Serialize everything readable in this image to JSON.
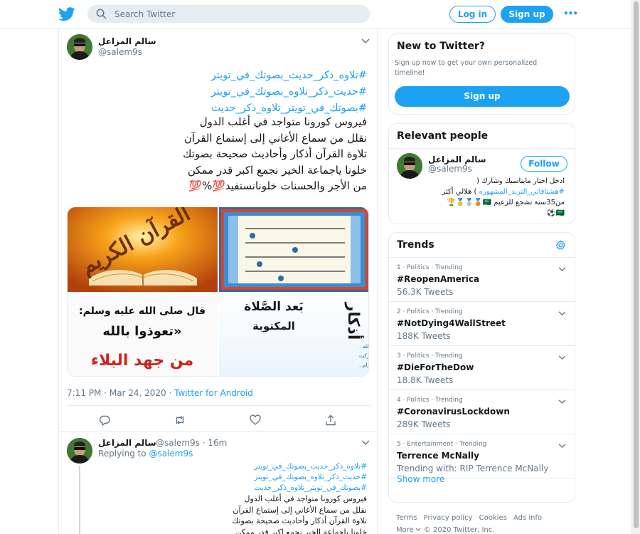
{
  "topbar": {
    "search_placeholder": "Search Twitter",
    "login_label": "Log in",
    "signup_label": "Sign up",
    "more_label": "•••"
  },
  "colors": {
    "accent": "#1da1f2",
    "text": "#14171a",
    "muted": "#657786",
    "border": "#e6ecf0"
  },
  "main_tweet": {
    "name": "سالم المزاعل",
    "handle": "@salem9s",
    "hashtags": [
      "#تلاوه_ذكر_حديث_بصوتك_في_تويتر",
      "#حديث_ذكر_تلاوه_بصوتك_في_تويتر",
      "#بصوتك_في_تويتر_تلاوه_ذكر_حديث"
    ],
    "lines": [
      "فيروس كورونا متواجد في أغلب الدول",
      "نقلل من سماع الأغاني إلى إستماع القرآن",
      "تلاوة القرآن أذكار وأحاديث صحيحة بصوتك",
      "خلونا ياجماعة الخير نجمع اكبر قدر ممكن",
      "من الأجر والحسنات خلونانستفيد💯%💯"
    ],
    "timestamp": "7:11 PM · Mar 24, 2020",
    "source_sep": " · ",
    "source": "Twitter for Android",
    "media": {
      "img1_text": "القرآن الكريم",
      "img3_line1": "قال صلى الله عليه وسلم:",
      "img3_line2": "«تعوذوا بالله",
      "img3_line3": "من جهد البلاء",
      "img4_line1": "أذكار",
      "img4_line2": "بَعد الصَّلاة",
      "img4_line3": "المكتوبة",
      "img4_line4": "• أستغفر الله ، أستغفر الله ، أستغفر الله .",
      "img4_line5": "• اللهم أنت السلام ، ومنك السلام ، تباركت",
      "img4_line6": "يا ذا الجلال والإكرام ."
    }
  },
  "reply_tweet": {
    "name": "سالم المزاعل",
    "handle_time": "@salem9s · 16m",
    "replying_prefix": "Replying to ",
    "replying_handle": "@salem9s",
    "hashtags": [
      "#تلاوه_ذكر_حديث_بصوتك_في_تويتر",
      "#حديث_ذكر_تلاوه_بصوتك_في_تويتر",
      "#بصوتك_في_تويتر_تلاوه_ذكر_حديث"
    ],
    "lines": [
      "فيروس كورونا متواجد في أغلب الدول",
      "نقلل من سماع الأغاني إلى إستماع القرآن",
      "تلاوة القرآن أذكار وأحاديث صحيحة بصوتك",
      "خلونا ياجماعة الخير نجمع اكبر قدر ممكن"
    ]
  },
  "new_to_twitter": {
    "title": "New to Twitter?",
    "desc": "Sign up now to get your own personalized timeline!",
    "button": "Sign up"
  },
  "relevant_people": {
    "title": "Relevant people",
    "name": "سالم المزاعل",
    "handle": "@salem9s",
    "follow": "Follow",
    "bio_line1": "ادخل اختار مايناسبك وشارك (",
    "bio_hashtag": "#هشتاقاتي_الترند_المشهوره",
    "bio_line2_rest": " ) هلالي أكثر",
    "bio_line3": "من35سنة نشجع للزعيم 🇸🇦🥉🥈🥇🏆",
    "bio_line4": "🇸🇦⚽"
  },
  "trends": {
    "title": "Trends",
    "items": [
      {
        "context": "1 · Politics · Trending",
        "name": "#ReopenAmerica",
        "count": "56.3K Tweets"
      },
      {
        "context": "2 · Politics · Trending",
        "name": "#NotDying4WallStreet",
        "count": "188K Tweets"
      },
      {
        "context": "3 · Politics · Trending",
        "name": "#DieForTheDow",
        "count": "18.8K Tweets"
      },
      {
        "context": "4 · Politics · Trending",
        "name": "#CoronavirusLockdown",
        "count": "289K Tweets"
      },
      {
        "context": "5 · Entertainment · Trending",
        "name": "Terrence McNally",
        "count": "Trending with: RIP Terrence McNally"
      }
    ],
    "show_more": "Show more"
  },
  "footer": {
    "links": [
      "Terms",
      "Privacy policy",
      "Cookies",
      "Ads info"
    ],
    "more": "More",
    "copyright": "© 2020 Twitter, Inc."
  }
}
